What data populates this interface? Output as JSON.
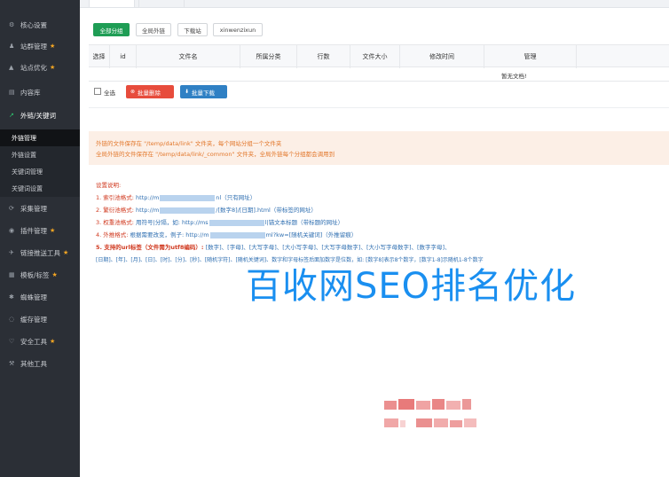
{
  "sidebar": {
    "items": [
      {
        "label": "核心设置",
        "icon": "gear-icon",
        "star": false
      },
      {
        "label": "站群管理",
        "icon": "user-icon",
        "star": true
      },
      {
        "label": "站点优化",
        "icon": "chart-icon",
        "star": true
      },
      {
        "label": "内容库",
        "icon": "doc-icon",
        "star": false
      },
      {
        "label": "外链/关键词",
        "icon": "link-icon",
        "star": false,
        "open": true
      },
      {
        "label": "采集管理",
        "icon": "collect-icon",
        "star": false
      },
      {
        "label": "插件管理",
        "icon": "plugin-icon",
        "star": true
      },
      {
        "label": "链接推送工具",
        "icon": "send-icon",
        "star": true
      },
      {
        "label": "模板/标签",
        "icon": "template-icon",
        "star": true
      },
      {
        "label": "蜘蛛管理",
        "icon": "spider-icon",
        "star": false
      },
      {
        "label": "缓存管理",
        "icon": "cache-icon",
        "star": false
      },
      {
        "label": "安全工具",
        "icon": "shield-icon",
        "star": true
      },
      {
        "label": "其他工具",
        "icon": "tools-icon",
        "star": false
      }
    ],
    "subitems": [
      "外链管理",
      "外链设置",
      "关键词管理",
      "关键词设置"
    ],
    "star_glyph": "★"
  },
  "toolbar": {
    "filters": [
      "全部分组",
      "全局外链",
      "下载站",
      "xinwenzixun"
    ]
  },
  "table": {
    "headers": [
      "选择",
      "id",
      "文件名",
      "所属分类",
      "行数",
      "文件大小",
      "修改时间",
      "管理"
    ],
    "empty_text": "暂无文档!"
  },
  "bulk": {
    "select_all": "全选",
    "delete_label": "批量删除",
    "download_label": "批量下载"
  },
  "notice": {
    "line1": "外链的文件保存在 \"/temp/data/link\" 文件夹，每个网站分组一个文件夹",
    "line2": "全局外链的文件保存在 \"/temp/data/link/_common\" 文件夹，全局外链每个分组都会调用到"
  },
  "instructions": {
    "title": "设置说明:",
    "l1_tag": "1. 索引池格式:",
    "l1_a": "http://m",
    "l1_b": "nl（只有网址）",
    "l2_tag": "2. 繁衍池格式:",
    "l2_a": "http://m",
    "l2_b": "/[数字8]/[日期].html（带标签的网址）",
    "l3_tag": "3. 权重池格式:",
    "l3_a": "用符号|分隔，如: http://ms",
    "l3_b": "l|锚文本标题（带标题的网址）",
    "l4_tag": "4. 外推格式:",
    "l4_a": "根据需要改变，例子: http://m",
    "l4_b": "ml?kw=[随机关键词]（外推留痕）",
    "l5_tag": "5. 支持的url标签（文件需为utf8编码）:",
    "l5_a": "[数字]、[字母]、[大写字母]、[大小写字母]、[大写字母数字]、[大小写字母数字]、[数字字母]、",
    "l6": "[日期]、[年]、[月]、[日]、[时]、[分]、[秒]、[随机字符]、[随机关键词]、数字和字母标签后面加数字是位数，如: [数字8]表示8个数字，[数字1-8]示随机1-8个数字"
  },
  "watermark": "百收网SEO排名优化"
}
